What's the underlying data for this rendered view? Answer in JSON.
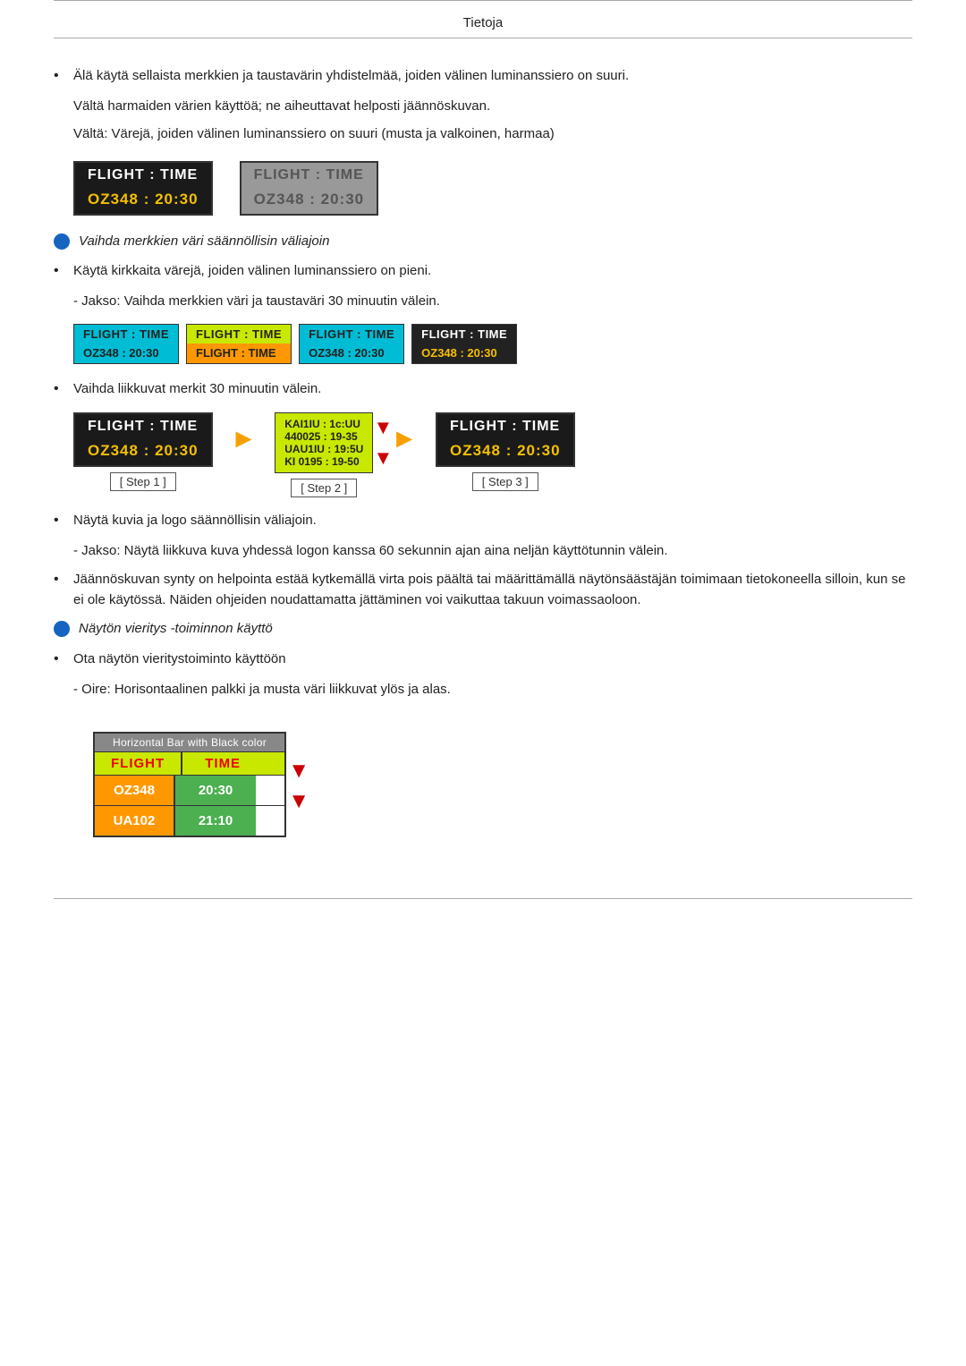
{
  "header": {
    "title": "Tietoja"
  },
  "sections": {
    "bullet1": {
      "text": "Älä käytä sellaista merkkien ja taustavärin yhdistelmää, joiden välinen luminanssiero on suuri."
    },
    "indent1": "Vältä harmaiden värien käyttöä; ne aiheuttavat helposti jäännöskuvan.",
    "indent2": "Vältä: Värejä, joiden välinen luminanssiero on suuri (musta ja valkoinen, harmaa)",
    "dark_box": {
      "row1": "FLIGHT  :  TIME",
      "row2": "OZ348   :  20:30"
    },
    "gray_box": {
      "row1": "FLIGHT  :  TIME",
      "row2": "OZ348   :  20:30"
    },
    "blue_note1": "Vaihda merkkien väri säännöllisin väliajoin",
    "bullet2": "Käytä kirkkaita värejä, joiden välinen luminanssiero on pieni.",
    "indent3": "- Jakso: Vaihda merkkien väri ja taustaväri 30 minuutin välein.",
    "cb1": {
      "r1": "FLIGHT  :  TIME",
      "r2": "OZ348  :  20:30"
    },
    "cb2": {
      "r1": "FLIGHT  :  TIME",
      "r2": "FLIGHT  :  TIME"
    },
    "cb3": {
      "r1": "FLIGHT  :  TIME",
      "r2": "OZ348  :  20:30"
    },
    "cb4": {
      "r1": "FLIGHT  :  TIME",
      "r2": "OZ348  :  20:30"
    },
    "bullet3": "Vaihda liikkuvat merkit 30 minuutin välein.",
    "step1_label": "[ Step 1 ]",
    "step1_box": {
      "r1": "FLIGHT  :  TIME",
      "r2": "OZ348   :  20:30"
    },
    "step2_label": "[ Step 2 ]",
    "step2_box": {
      "r1": "KAI1IU  :  1c:UU",
      "r2": "440025  :  19-35",
      "r3": "UAU1IU  :  19:5U",
      "r4": "KI 0195  :  19-50"
    },
    "step3_label": "[ Step 3 ]",
    "step3_box": {
      "r1": "FLIGHT  :  TIME",
      "r2": "OZ348   :  20:30"
    },
    "bullet4": "Näytä kuvia ja logo säännöllisin väliajoin.",
    "indent4": "- Jakso: Näytä liikkuva kuva yhdessä logon kanssa 60 sekunnin ajan aina neljän käyttötunnin välein.",
    "bullet5": "Jäännöskuvan synty on helpointa estää kytkemällä virta pois päältä tai määrittämällä näytönsäästäjän toimimaan tietokoneella silloin, kun se ei ole käytössä. Näiden ohjeiden noudattamatta jättäminen voi vaikuttaa takuun voimassaoloon.",
    "blue_note2": "Näytön vieritys -toiminnon käyttö",
    "bullet6": "Ota näytön vieritystoiminto käyttöön",
    "indent5": "- Oire: Horisontaalinen palkki ja musta väri liikkuvat ylös ja alas.",
    "hbar_title": "Horizontal Bar with Black color",
    "hbar_row_header": {
      "left": "FLIGHT",
      "right": "TIME"
    },
    "hbar_row1": {
      "left": "OZ348",
      "right": "20:30"
    },
    "hbar_row2": {
      "left": "UA102",
      "right": "21:10"
    }
  }
}
